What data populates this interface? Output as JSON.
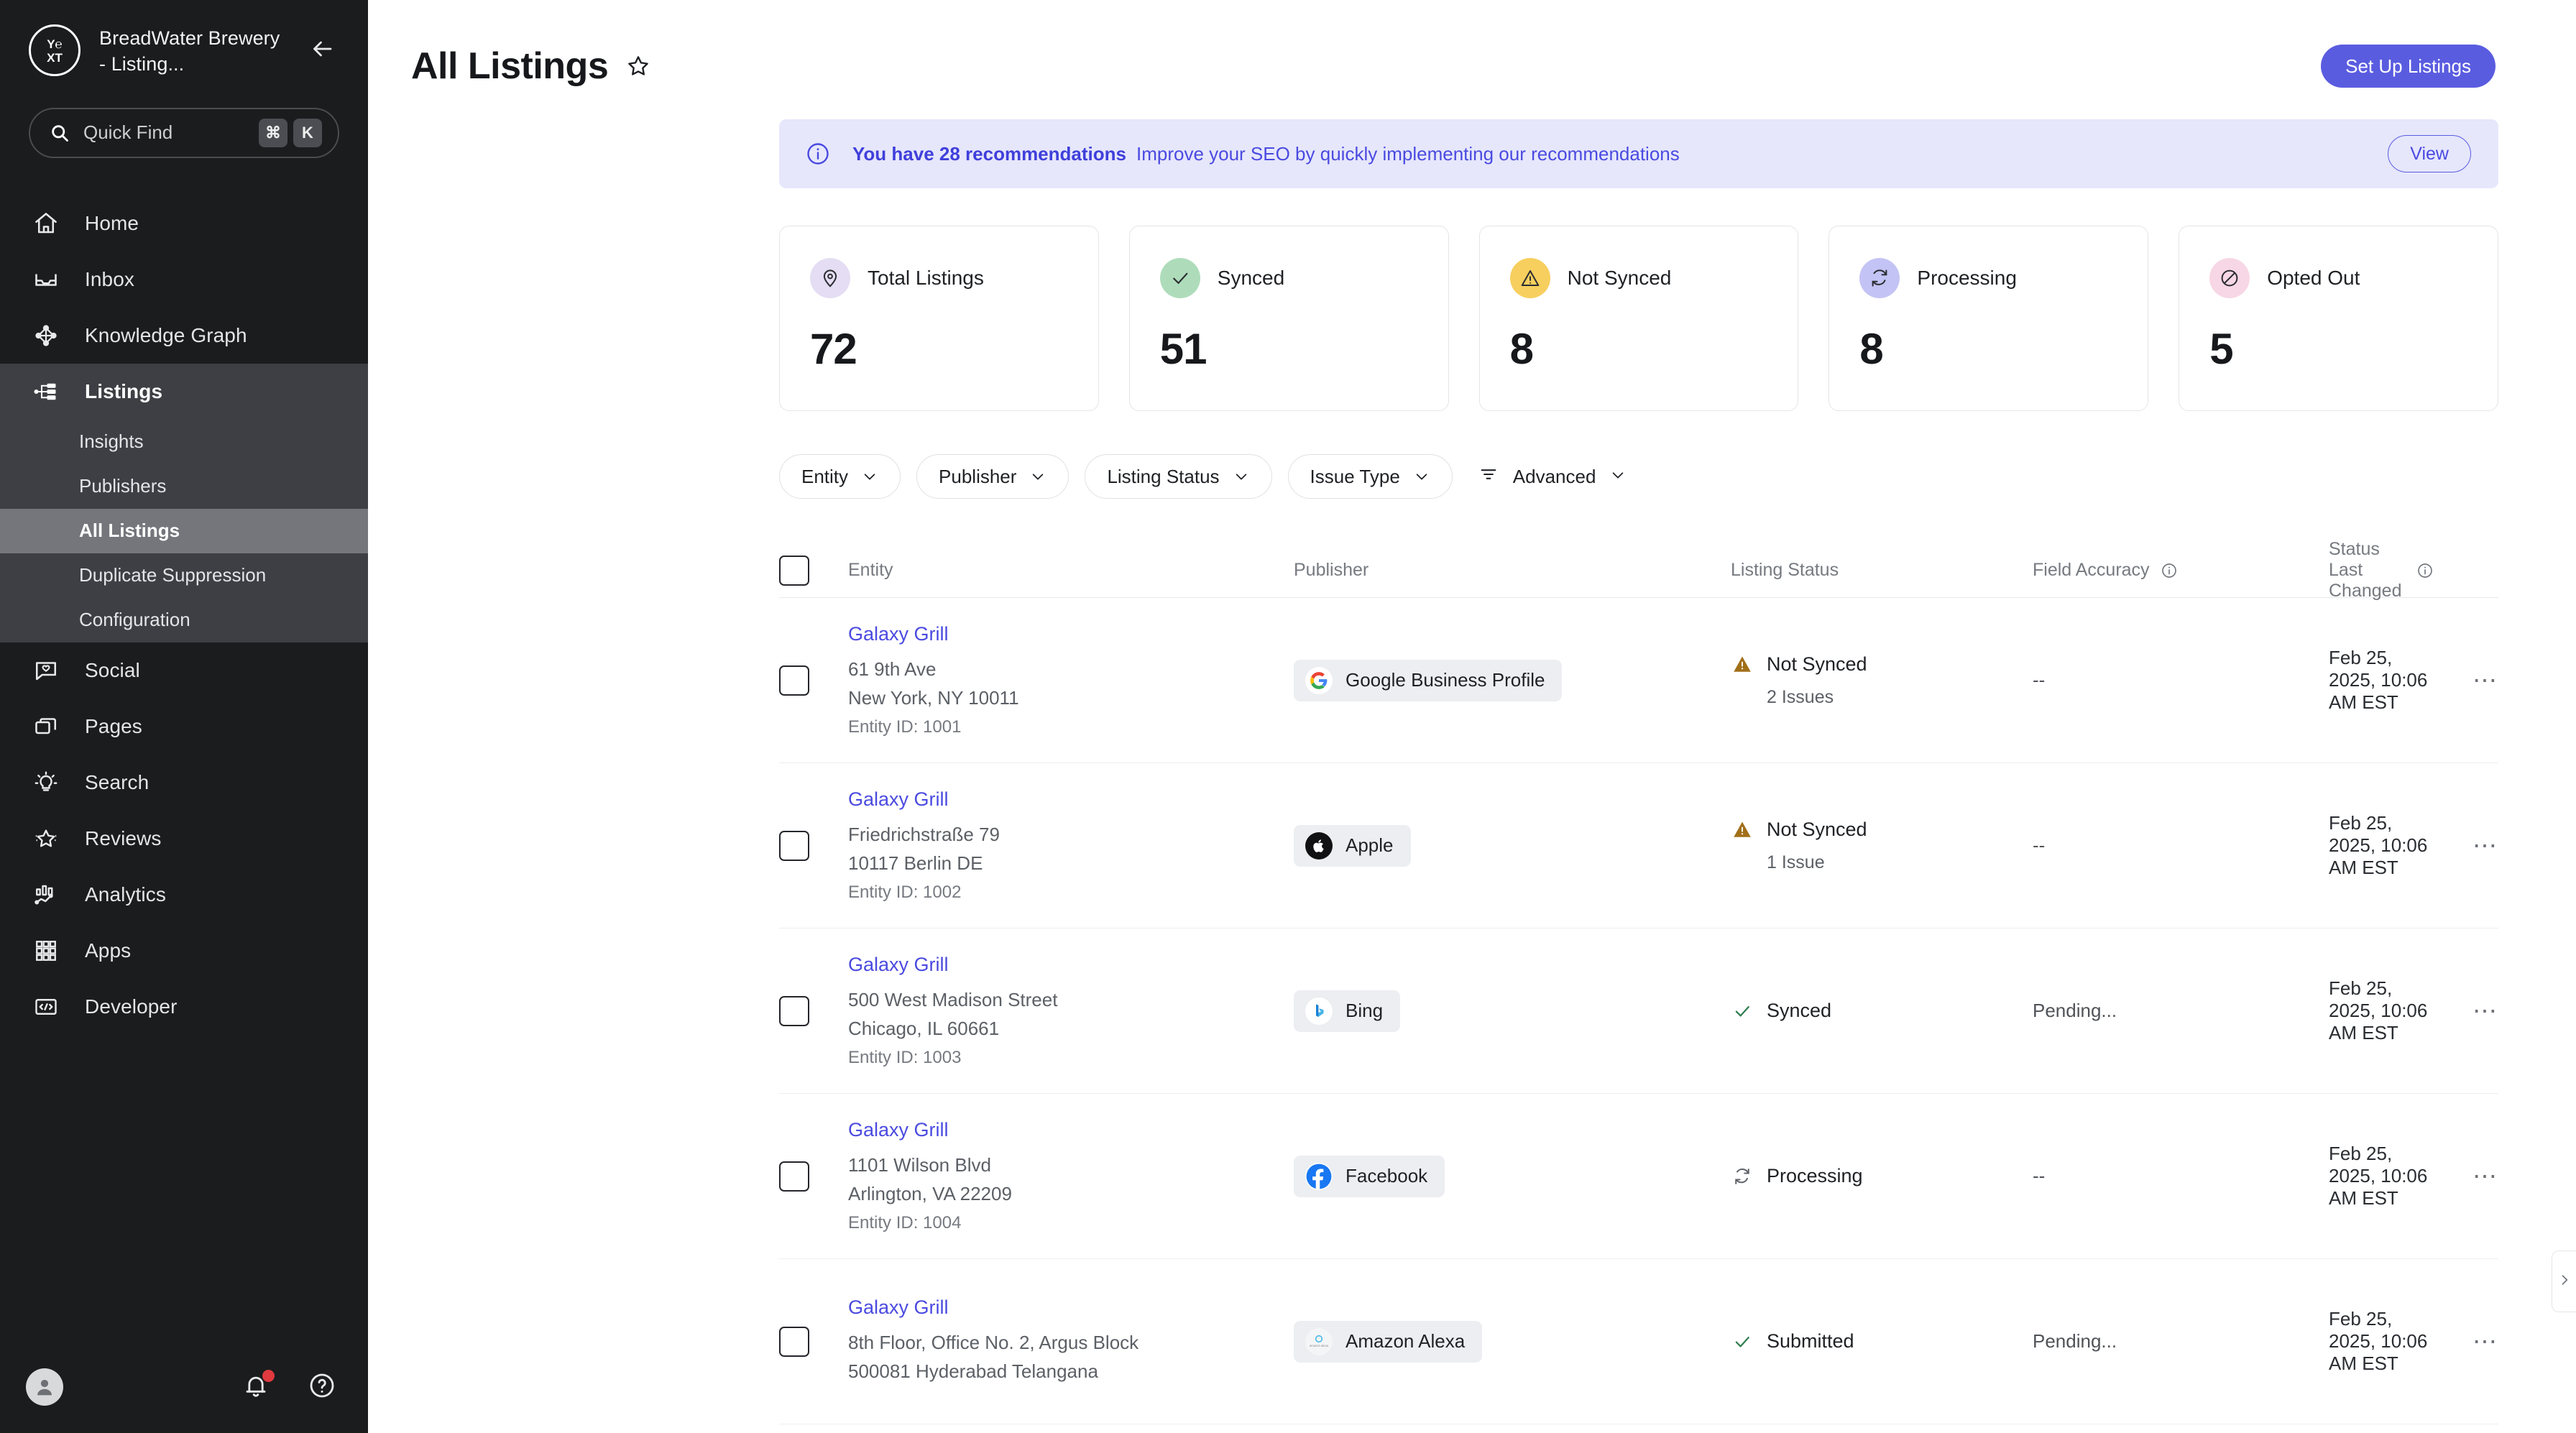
{
  "sidebar": {
    "brand": {
      "name": "BreadWater Brewery - Listing...",
      "logo_icon": "yext-logo"
    },
    "back_icon": "arrow-left-icon",
    "quick_find": {
      "placeholder": "Quick Find",
      "icon": "search-icon",
      "keys": [
        "⌘",
        "K"
      ]
    },
    "nav": [
      {
        "label": "Home",
        "icon": "home-icon"
      },
      {
        "label": "Inbox",
        "icon": "inbox-icon"
      },
      {
        "label": "Knowledge Graph",
        "icon": "knowledge-graph-icon"
      }
    ],
    "group": {
      "label": "Listings",
      "icon": "listings-icon",
      "sub_items": [
        {
          "label": "Insights",
          "active": false
        },
        {
          "label": "Publishers",
          "active": false
        },
        {
          "label": "All Listings",
          "active": true
        },
        {
          "label": "Duplicate Suppression",
          "active": false
        },
        {
          "label": "Configuration",
          "active": false
        }
      ]
    },
    "nav_after": [
      {
        "label": "Social",
        "icon": "social-icon"
      },
      {
        "label": "Pages",
        "icon": "pages-icon"
      },
      {
        "label": "Search",
        "icon": "search-bulb-icon"
      },
      {
        "label": "Reviews",
        "icon": "reviews-star-icon"
      },
      {
        "label": "Analytics",
        "icon": "analytics-icon"
      },
      {
        "label": "Apps",
        "icon": "apps-grid-icon"
      },
      {
        "label": "Developer",
        "icon": "developer-code-icon"
      }
    ],
    "bottom": {
      "avatar_icon": "user-avatar-icon",
      "bell_icon": "bell-icon",
      "help_icon": "help-circle-icon",
      "has_notification": true
    }
  },
  "header": {
    "title": "All Listings",
    "star_icon": "star-outline-icon",
    "primary_button": "Set Up Listings"
  },
  "banner": {
    "icon": "info-circle-icon",
    "bold_text": "You have 28 recommendations",
    "sub_text": "Improve your SEO by quickly implementing our recommendations",
    "action_label": "View"
  },
  "stats": [
    {
      "label": "Total Listings",
      "value": "72",
      "icon": "map-pin-icon",
      "bubble_color": "#e4ddf3",
      "icon_color": "#2b2d31"
    },
    {
      "label": "Synced",
      "value": "51",
      "icon": "check-icon",
      "bubble_color": "#aedcba",
      "icon_color": "#2b2d31"
    },
    {
      "label": "Not Synced",
      "value": "8",
      "icon": "warning-triangle-icon",
      "bubble_color": "#f7cf5e",
      "icon_color": "#2b2d31"
    },
    {
      "label": "Processing",
      "value": "8",
      "icon": "refresh-icon",
      "bubble_color": "#c3c3f5",
      "icon_color": "#2b2d31"
    },
    {
      "label": "Opted Out",
      "value": "5",
      "icon": "block-circle-icon",
      "bubble_color": "#f7d7e5",
      "icon_color": "#2b2d31"
    }
  ],
  "filters": [
    {
      "label": "Entity",
      "icon": "chevron-down-icon"
    },
    {
      "label": "Publisher",
      "icon": "chevron-down-icon"
    },
    {
      "label": "Listing Status",
      "icon": "chevron-down-icon"
    },
    {
      "label": "Issue Type",
      "icon": "chevron-down-icon"
    }
  ],
  "advanced_filter": {
    "label": "Advanced",
    "icon": "filter-lines-icon",
    "chevron": "chevron-down-icon"
  },
  "table": {
    "columns": [
      {
        "label": "Entity",
        "info": false
      },
      {
        "label": "Publisher",
        "info": false
      },
      {
        "label": "Listing Status",
        "info": false
      },
      {
        "label": "Field Accuracy",
        "info": true
      },
      {
        "label": "Status Last Changed",
        "info": true
      }
    ],
    "rows": [
      {
        "entity_name": "Galaxy Grill",
        "address_line1": "61 9th Ave",
        "address_line2": "New York, NY 10011",
        "entity_id": "Entity ID: 1001",
        "publisher": "Google Business Profile",
        "publisher_logo": "google-logo",
        "status": "Not Synced",
        "status_icon": "warning-triangle-icon",
        "status_color": "#a16f19",
        "issues": "2 Issues",
        "field_accuracy": "--",
        "status_last_changed": "Feb 25, 2025, 10:06 AM EST",
        "menu_icon": "kebab-menu-icon"
      },
      {
        "entity_name": "Galaxy Grill",
        "address_line1": "Friedrichstraße 79",
        "address_line2": "10117 Berlin DE",
        "entity_id": "Entity ID: 1002",
        "publisher": "Apple",
        "publisher_logo": "apple-logo",
        "status": "Not Synced",
        "status_icon": "warning-triangle-icon",
        "status_color": "#a16f19",
        "issues": "1 Issue",
        "field_accuracy": "--",
        "status_last_changed": "Feb 25, 2025, 10:06 AM EST",
        "menu_icon": "kebab-menu-icon"
      },
      {
        "entity_name": "Galaxy Grill",
        "address_line1": "500 West Madison Street",
        "address_line2": "Chicago, IL 60661",
        "entity_id": "Entity ID: 1003",
        "publisher": "Bing",
        "publisher_logo": "bing-logo",
        "status": "Synced",
        "status_icon": "check-icon",
        "status_color": "#2f7d4f",
        "issues": "",
        "field_accuracy": "Pending...",
        "status_last_changed": "Feb 25, 2025, 10:06 AM EST",
        "menu_icon": "kebab-menu-icon"
      },
      {
        "entity_name": "Galaxy Grill",
        "address_line1": "1101 Wilson Blvd",
        "address_line2": "Arlington, VA 22209",
        "entity_id": "Entity ID: 1004",
        "publisher": "Facebook",
        "publisher_logo": "facebook-logo",
        "status": "Processing",
        "status_icon": "refresh-icon",
        "status_color": "#5c6066",
        "issues": "",
        "field_accuracy": "--",
        "status_last_changed": "Feb 25, 2025, 10:06 AM EST",
        "menu_icon": "kebab-menu-icon"
      },
      {
        "entity_name": "Galaxy Grill",
        "address_line1": "8th Floor, Office No. 2, Argus Block",
        "address_line2": "500081 Hyderabad Telangana",
        "entity_id": "",
        "publisher": "Amazon Alexa",
        "publisher_logo": "amazon-alexa-logo",
        "status": "Submitted",
        "status_icon": "check-icon",
        "status_color": "#2f7d4f",
        "issues": "",
        "field_accuracy": "Pending...",
        "status_last_changed": "Feb 25, 2025, 10:06 AM EST",
        "menu_icon": "kebab-menu-icon"
      }
    ]
  },
  "side_panel_handle": {
    "icon": "chevron-left-icon"
  },
  "colors": {
    "accent": "#5a5ce0",
    "link": "#4a4ae0",
    "banner_bg": "#e6e7fb",
    "sidebar_bg": "#1b1c1e"
  }
}
